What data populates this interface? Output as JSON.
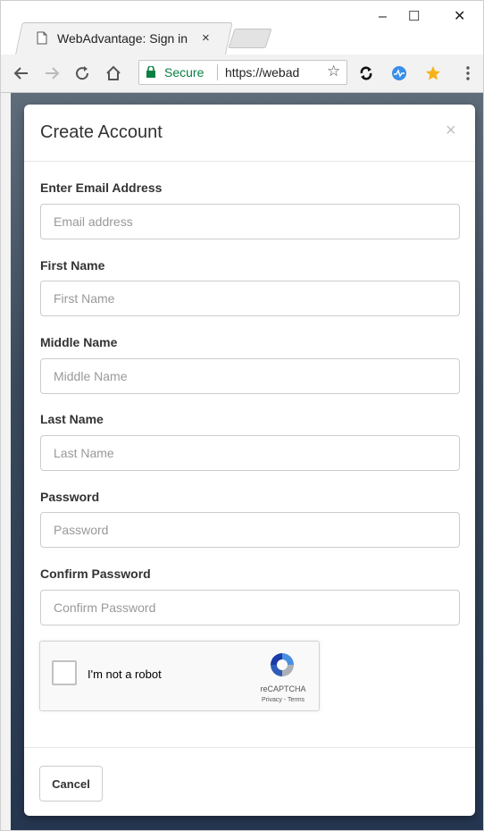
{
  "browser": {
    "tab_title": "WebAdvantage: Sign in",
    "tab_close": "×",
    "minimize": "–",
    "maximize": "☐",
    "close": "✕",
    "secure_label": "Secure",
    "url": "https://webad"
  },
  "modal": {
    "title": "Create Account",
    "close_label": "×",
    "fields": [
      {
        "label": "Enter Email Address",
        "placeholder": "Email address",
        "value": ""
      },
      {
        "label": "First Name",
        "placeholder": "First Name",
        "value": ""
      },
      {
        "label": "Middle Name",
        "placeholder": "Middle Name",
        "value": ""
      },
      {
        "label": "Last Name",
        "placeholder": "Last Name",
        "value": ""
      },
      {
        "label": "Password",
        "placeholder": "Password",
        "value": ""
      },
      {
        "label": "Confirm Password",
        "placeholder": "Confirm Password",
        "value": ""
      }
    ],
    "captcha": {
      "label": "I'm not a robot",
      "brand": "reCAPTCHA",
      "links": "Privacy - Terms",
      "checked": false
    },
    "cancel_label": "Cancel"
  },
  "colors": {
    "secure_green": "#0b8043",
    "page_background": "#253650"
  }
}
